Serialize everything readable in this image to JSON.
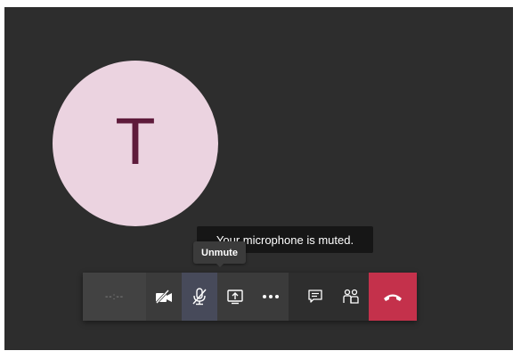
{
  "participant": {
    "initial": "T"
  },
  "banner": {
    "text": "Your microphone is muted."
  },
  "tooltip": {
    "text": "Unmute"
  },
  "toolbar": {
    "timer": "--:--",
    "buttons": [
      {
        "name": "camera",
        "icon": "camera-off-icon"
      },
      {
        "name": "microphone",
        "icon": "mic-off-icon",
        "state": "muted"
      },
      {
        "name": "share",
        "icon": "share-screen-icon"
      },
      {
        "name": "more",
        "icon": "more-icon"
      },
      {
        "name": "chat",
        "icon": "chat-icon"
      },
      {
        "name": "participants",
        "icon": "people-icon"
      },
      {
        "name": "hang-up",
        "icon": "hang-up-icon"
      }
    ]
  },
  "colors": {
    "stage": "#2d2d2d",
    "avatar_bg": "#ebd3e0",
    "avatar_text": "#5e1b3b",
    "hangup": "#c4314b",
    "active_button": "#474a5a"
  }
}
